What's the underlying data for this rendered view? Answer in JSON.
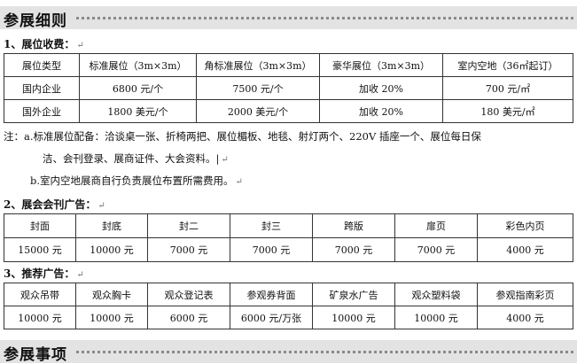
{
  "section1": {
    "title": "参展细则"
  },
  "part1": {
    "heading": "1、展位收费：",
    "headers": [
      "展位类型",
      "标准展位（3m×3m）",
      "角标准展位（3m×3m）",
      "豪华展位（3m×3m）",
      "室内空地（36㎡起订）"
    ],
    "rows": [
      [
        "国内企业",
        "6800 元/个",
        "7500 元/个",
        "加收 20%",
        "700 元/㎡"
      ],
      [
        "国外企业",
        "1800 美元/个",
        "2000 美元/个",
        "加收 20%",
        "180 美元/㎡"
      ]
    ]
  },
  "notes": {
    "a_prefix": "注：a.标准展位配备：",
    "a_line1": "洽谈桌一张、折椅两把、展位楣板、地毯、射灯两个、220V 插座一个、展位每日保",
    "a_line2": "洁、会刊登录、展商证件、大会资料。",
    "b_line": "b.室内空地展商自行负责展位布置所需费用。"
  },
  "part2": {
    "heading": "2、展会会刊广告：",
    "headers": [
      "封面",
      "封底",
      "封二",
      "封三",
      "跨版",
      "扉页",
      "彩色内页"
    ],
    "values": [
      "15000 元",
      "10000 元",
      "7000 元",
      "7000 元",
      "7000 元",
      "7000 元",
      "4000 元"
    ]
  },
  "part3": {
    "heading": "3、推荐广告：",
    "headers": [
      "观众吊带",
      "观众胸卡",
      "观众登记表",
      "参观券背面",
      "矿泉水广告",
      "观众塑料袋",
      "参观指南彩页"
    ],
    "values": [
      "10000 元",
      "10000 元",
      "6000 元",
      "6000 元/万张",
      "10000 元",
      "10000 元",
      "4000 元"
    ]
  },
  "section2": {
    "title": "参展事项"
  },
  "symbols": {
    "return_mark": "↵",
    "cursor": "|"
  }
}
